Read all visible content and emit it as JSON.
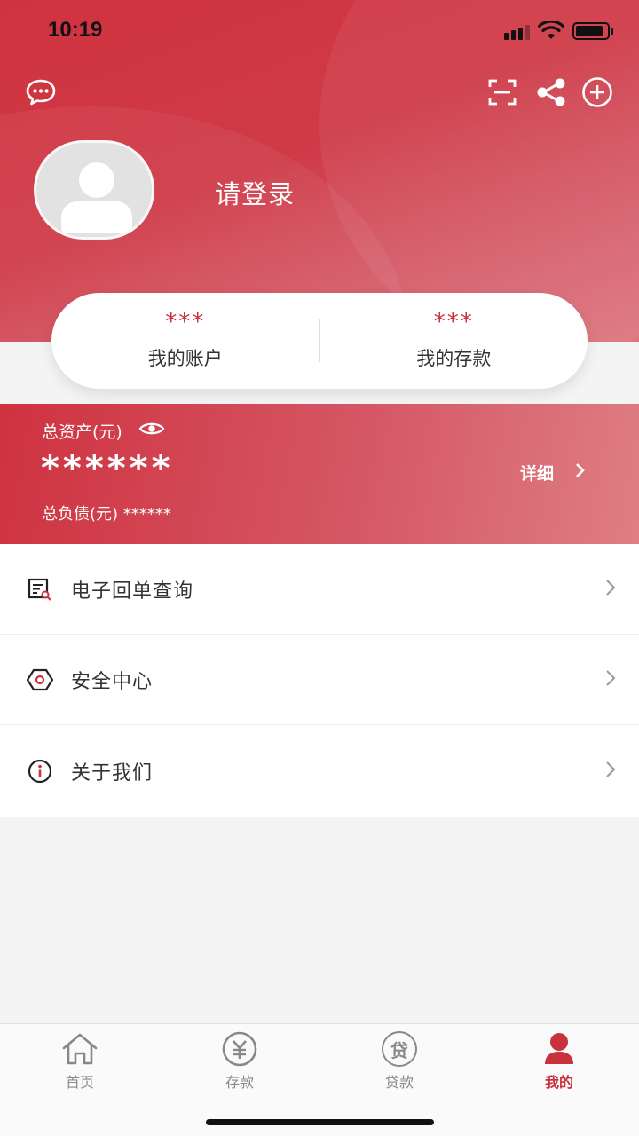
{
  "status_bar": {
    "time": "10:19"
  },
  "profile": {
    "login_prompt": "请登录"
  },
  "summary": [
    {
      "value": "***",
      "label": "我的账户"
    },
    {
      "value": "***",
      "label": "我的存款"
    }
  ],
  "assets": {
    "total_label": "总资产(元)",
    "total_value": "******",
    "debt_label": "总负债(元)",
    "debt_value": "******",
    "detail_label": "详细"
  },
  "menu": [
    {
      "label": "电子回单查询",
      "icon": "receipt-search-icon"
    },
    {
      "label": "安全中心",
      "icon": "security-hexagon-icon"
    },
    {
      "label": "关于我们",
      "icon": "info-icon"
    }
  ],
  "tabbar": [
    {
      "label": "首页",
      "icon": "home-icon"
    },
    {
      "label": "存款",
      "icon": "yuan-icon"
    },
    {
      "label": "贷款",
      "icon": "loan-icon",
      "glyph": "贷"
    },
    {
      "label": "我的",
      "icon": "user-icon"
    }
  ],
  "colors": {
    "accent": "#c8323d",
    "header_gradient": [
      "#d0333f",
      "#dc7580"
    ]
  }
}
